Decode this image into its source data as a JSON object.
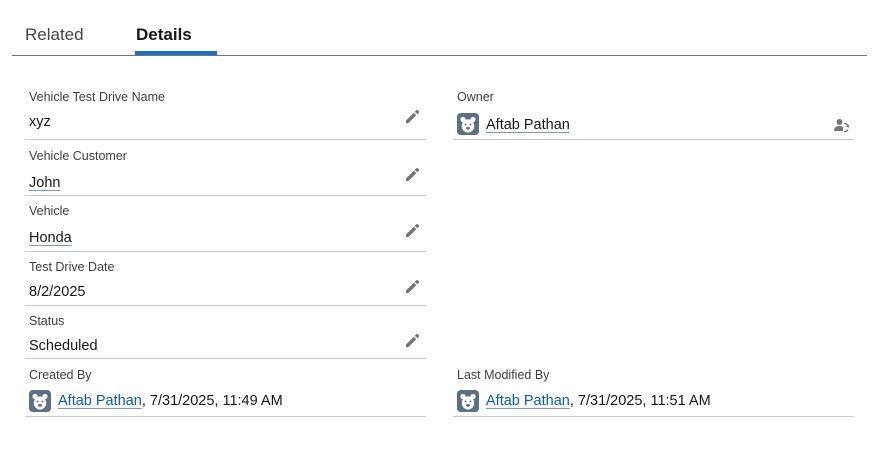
{
  "tabs": {
    "related": "Related",
    "details": "Details"
  },
  "fields": {
    "test_drive_name": {
      "label": "Vehicle Test Drive Name",
      "value": "xyz"
    },
    "customer": {
      "label": "Vehicle Customer",
      "value": "John"
    },
    "vehicle": {
      "label": "Vehicle",
      "value": "Honda"
    },
    "test_drive_date": {
      "label": "Test Drive Date",
      "value": "8/2/2025"
    },
    "status": {
      "label": "Status",
      "value": "Scheduled"
    },
    "owner": {
      "label": "Owner",
      "value": "Aftab Pathan"
    },
    "created_by": {
      "label": "Created By",
      "user": "Aftab Pathan",
      "separator": ",",
      "timestamp": "7/31/2025, 11:49 AM"
    },
    "last_modified_by": {
      "label": "Last Modified By",
      "user": "Aftab Pathan",
      "separator": ",",
      "timestamp": "7/31/2025, 11:51 AM"
    }
  },
  "colors": {
    "link": "#0b5cab",
    "active_tab_underline": "#1b72c4",
    "avatar_bg": "#5c6f85"
  },
  "icons": {
    "edit": "pencil-icon",
    "avatar": "bear-avatar-icon",
    "change_owner": "change-owner-icon"
  }
}
